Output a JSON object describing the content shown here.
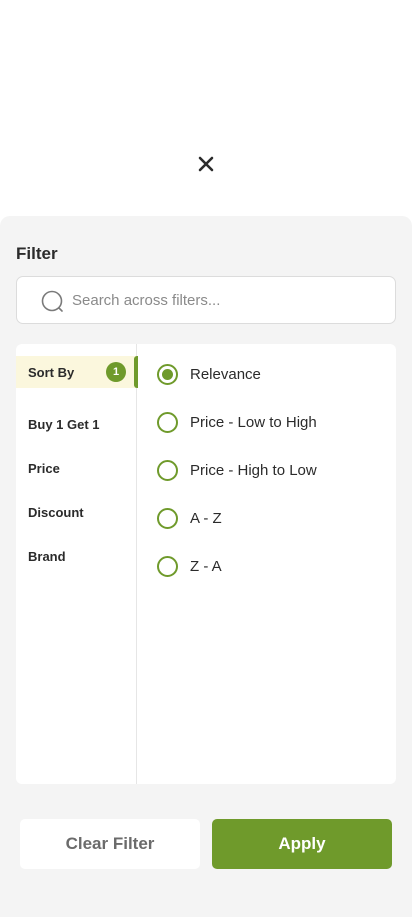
{
  "close": {
    "icon": "close-icon"
  },
  "filter": {
    "title": "Filter",
    "search": {
      "placeholder": "Search across filters...",
      "value": "",
      "icon": "search-icon"
    },
    "categories": [
      {
        "label": "Sort By",
        "badge": "1",
        "active": true
      },
      {
        "label": "Buy 1 Get 1"
      },
      {
        "label": "Price"
      },
      {
        "label": "Discount"
      },
      {
        "label": "Brand"
      }
    ],
    "options": [
      {
        "label": "Relevance",
        "selected": true
      },
      {
        "label": "Price - Low to High"
      },
      {
        "label": "Price - High to Low"
      },
      {
        "label": "A - Z"
      },
      {
        "label": "Z - A"
      }
    ]
  },
  "actions": {
    "clear_label": "Clear Filter",
    "apply_label": "Apply"
  },
  "colors": {
    "accent": "#6f9a2b",
    "active_category_bg": "#fbf7dd",
    "sheet_bg": "#f4f4f4"
  }
}
